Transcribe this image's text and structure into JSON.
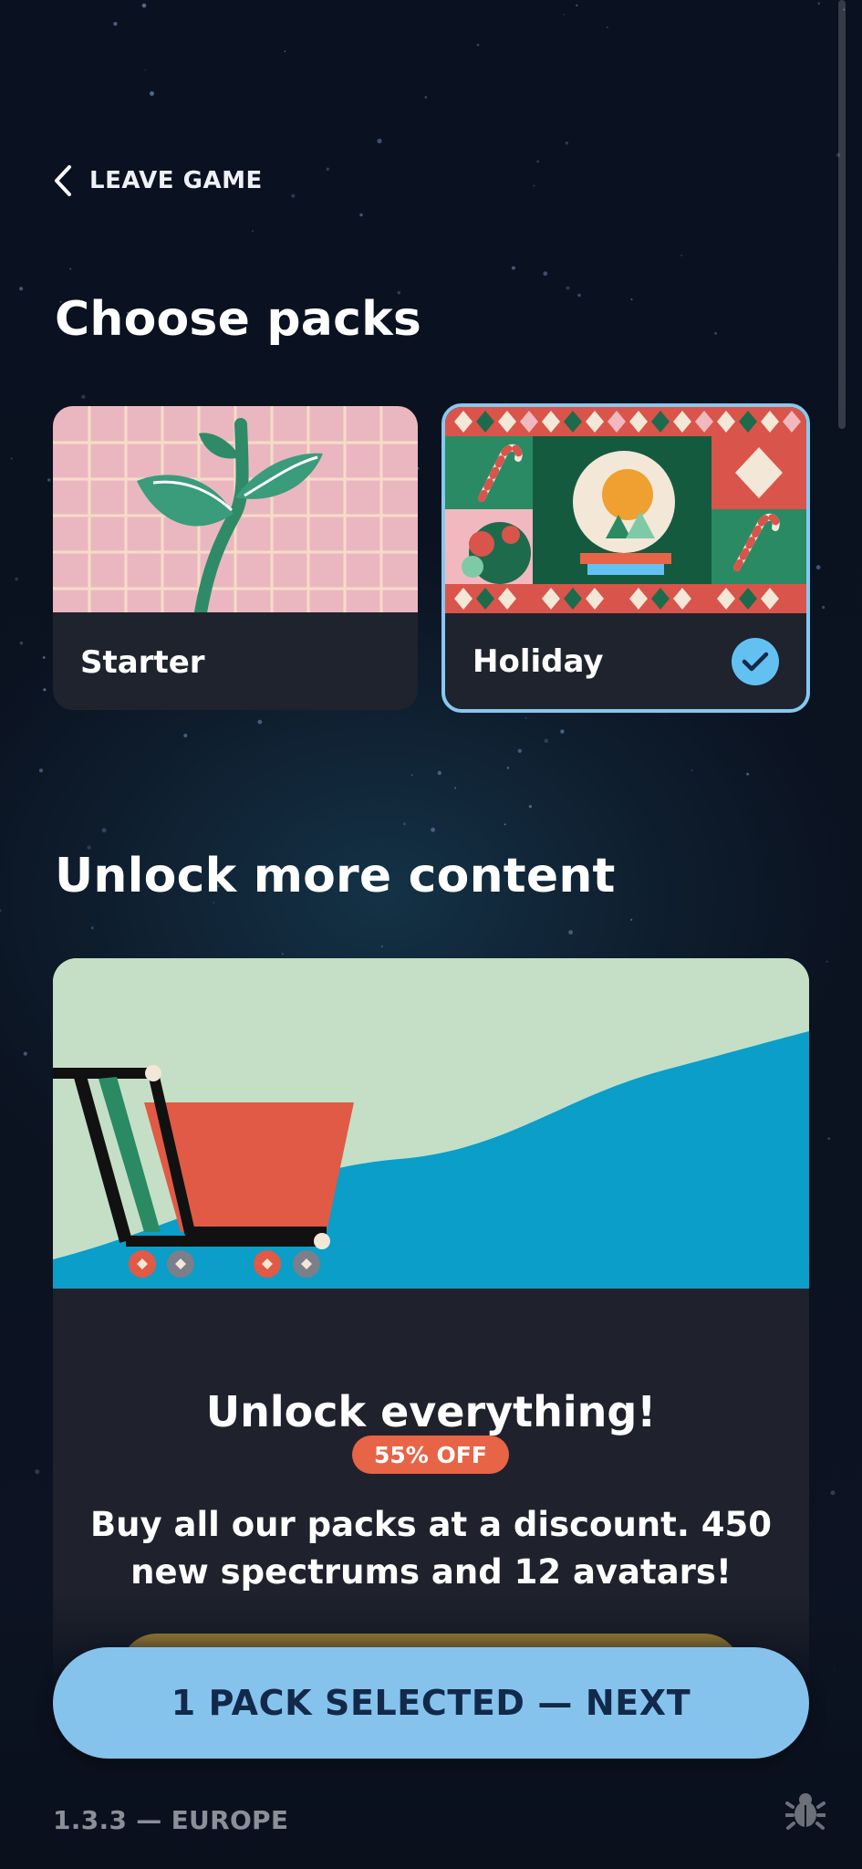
{
  "nav": {
    "leave_label": "LEAVE GAME"
  },
  "headings": {
    "choose": "Choose packs",
    "unlock": "Unlock more content"
  },
  "packs": [
    {
      "title": "Starter",
      "selected": false
    },
    {
      "title": "Holiday",
      "selected": true
    }
  ],
  "promo": {
    "title": "Unlock everything!",
    "discount": "55% OFF",
    "text": "Buy all our packs at a discount. 450 new spectrums and 12 avatars!"
  },
  "footer": {
    "next_label": "1 PACK SELECTED — NEXT",
    "version": "1.3.3 — EUROPE"
  },
  "icons": {
    "back": "chevron-left-icon",
    "check": "checkmark-icon",
    "bug": "bug-icon"
  },
  "colors": {
    "background": "#0b1220",
    "accent_blue": "#86c3ec",
    "check_blue": "#63c1f2",
    "discount_orange": "#e86447",
    "card": "#1f222c"
  }
}
